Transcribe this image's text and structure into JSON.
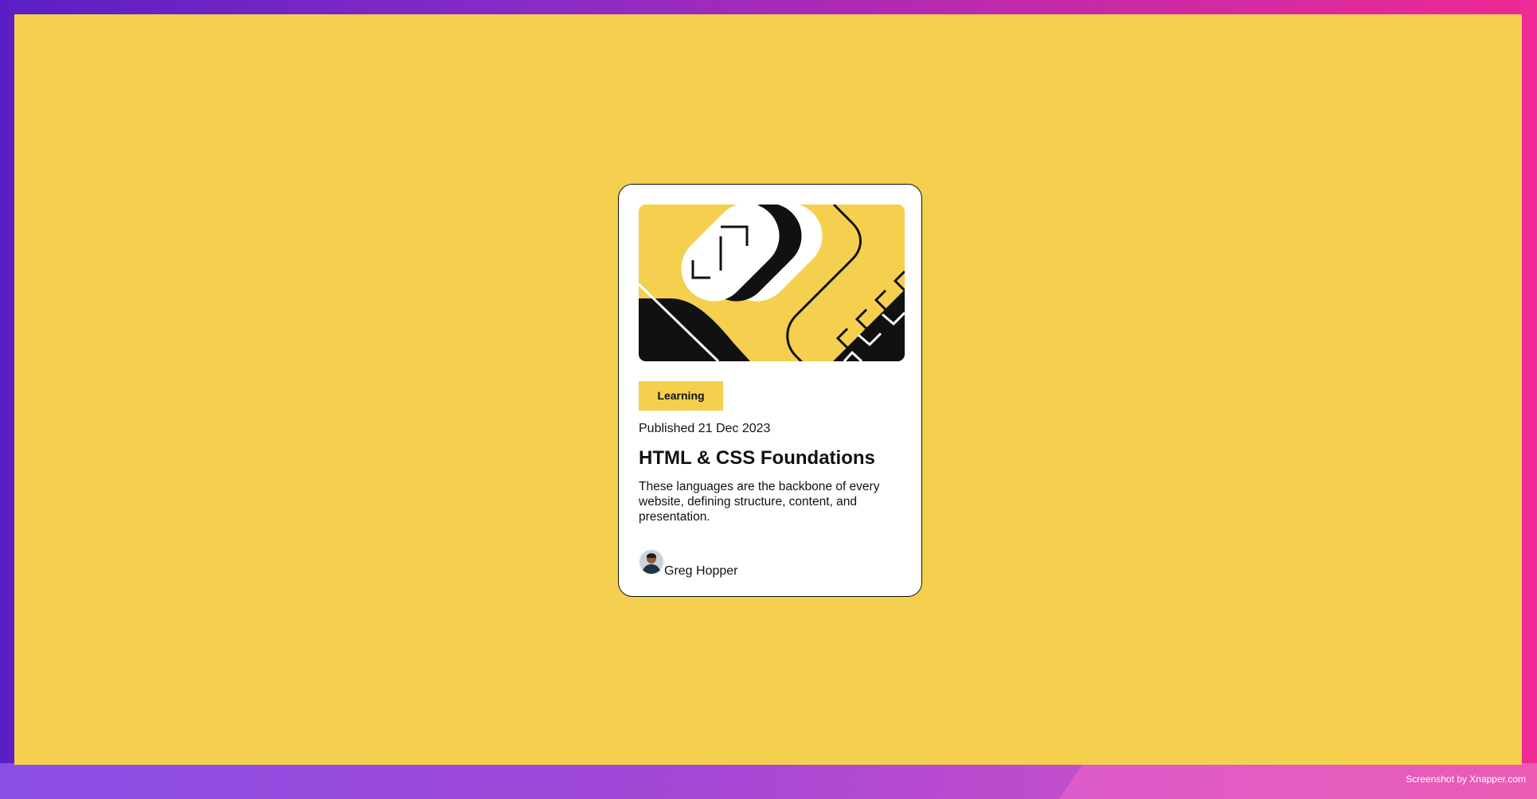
{
  "colors": {
    "background_yellow": "#f4d04e",
    "card_white": "#ffffff",
    "ink_black": "#111111"
  },
  "card": {
    "illustration_icon": "abstract-geometric-illustration",
    "tag": "Learning",
    "published": "Published 21 Dec 2023",
    "title": "HTML & CSS Foundations",
    "description": "These languages are the backbone of every website, defining structure, content, and presentation.",
    "author": {
      "avatar_icon": "author-avatar",
      "name": "Greg Hopper"
    }
  },
  "footer": {
    "credit": "Screenshot by Xnapper.com"
  }
}
